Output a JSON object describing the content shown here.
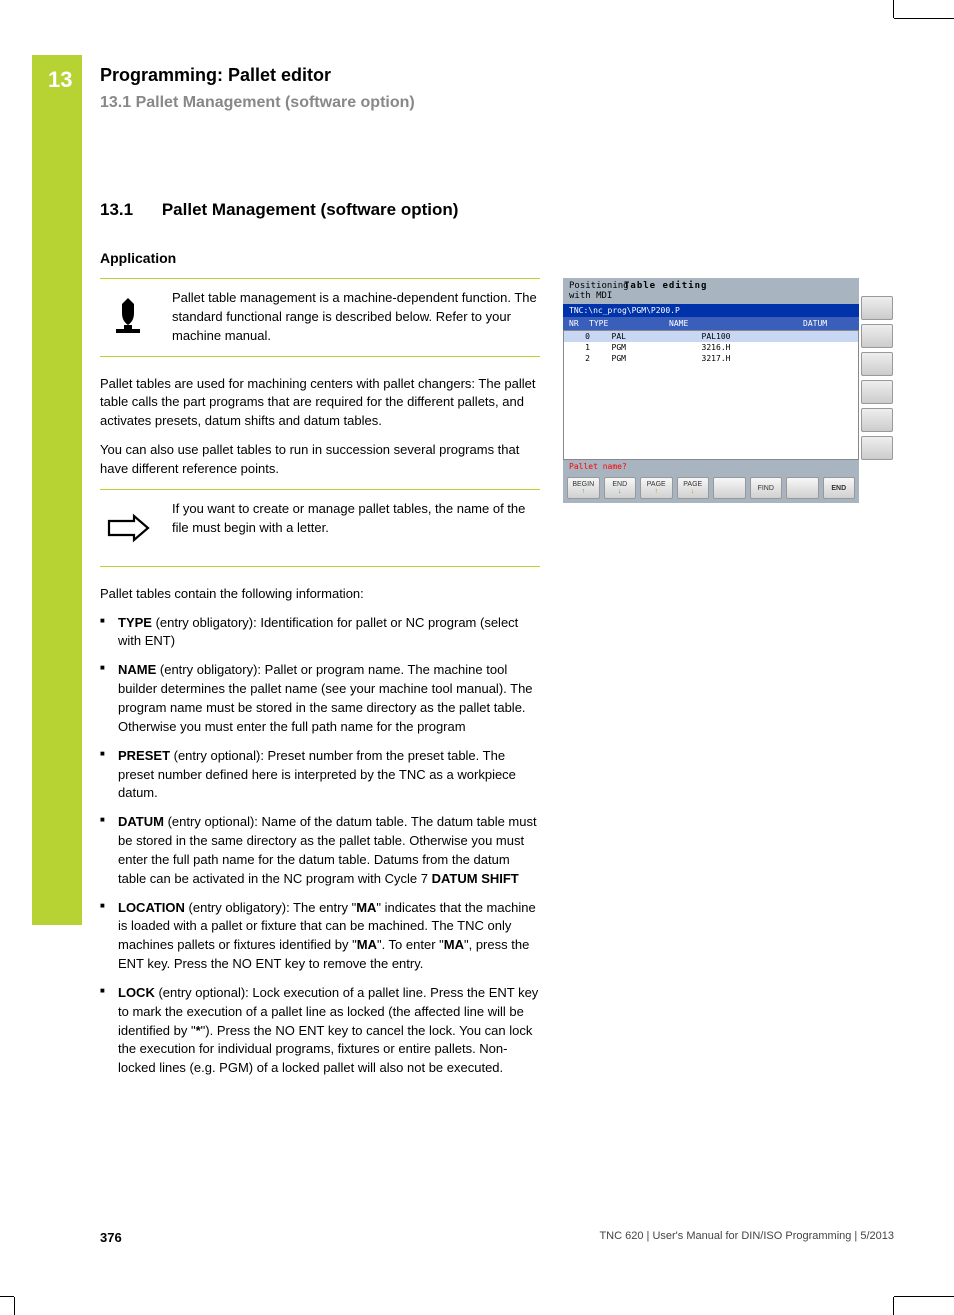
{
  "chapter_num": "13",
  "top_header": {
    "line1": "Programming: Pallet editor",
    "line2": "13.1   Pallet Management (software option)"
  },
  "section_title": {
    "num": "13.1",
    "text": "Pallet Management (software option)"
  },
  "subhead": "Application",
  "callout1_text": "Pallet table management is a machine-dependent function. The standard functional range is described below. Refer to your machine manual.",
  "para1": "Pallet tables are used for machining centers with pallet changers: The pallet table calls the part programs that are required for the different pallets, and activates presets, datum shifts and datum tables.",
  "para2": "You can also use pallet tables to run in succession several programs that have different reference points.",
  "callout2_text": "If you want to create or manage pallet tables, the name of the file must begin with a letter.",
  "para3": "Pallet tables contain the following information:",
  "fields": [
    {
      "name": "TYPE",
      "body": " (entry obligatory): Identification for pallet or NC program (select with ENT)"
    },
    {
      "name": "NAME",
      "body": " (entry obligatory): Pallet or program name. The machine tool builder determines the pallet name (see your machine tool manual). The program name must be stored in the same directory as the pallet table. Otherwise you must enter the full path name for the program"
    },
    {
      "name": "PRESET",
      "body": " (entry optional): Preset number from the preset table. The preset number defined here is interpreted by the TNC as a workpiece datum."
    },
    {
      "name": "DATUM",
      "body": " (entry optional): Name of the datum table. The datum table must be stored in the same directory as the pallet table. Otherwise you must enter the full path name for the datum table. Datums from the datum table can be activated in the NC program with Cycle 7 ",
      "tail_bold": "DATUM SHIFT"
    },
    {
      "name": "LOCATION",
      "body": " (entry obligatory): The entry \"",
      "mid_bold": "MA",
      "body2": "\" indicates that the machine is loaded with a pallet or fixture that can be machined. The TNC only machines pallets or fixtures identified by \"",
      "mid_bold2": "MA",
      "body3": "\". To enter \"",
      "mid_bold3": "MA",
      "body4": "\", press the ENT key. Press the NO ENT key to remove the entry."
    },
    {
      "name": "LOCK",
      "body": " (entry optional): Lock execution of a pallet line. Press the ENT key to mark the execution of a pallet line as locked (the affected line will be identified by \"",
      "mid_bold": "*",
      "body2": "\"). Press the NO ENT key to cancel the lock. You can lock the execution for individual programs, fixtures or entire pallets. Non-locked lines (e.g. PGM) of a locked pallet will also not be executed."
    }
  ],
  "screenshot": {
    "mode": "Positioning\nwith MDI",
    "title": "Table editing",
    "path": "TNC:\\nc_prog\\PGM\\P200.P",
    "cols": [
      "NR",
      "TYPE",
      "NAME",
      "DATUM"
    ],
    "rows": [
      {
        "nr": "0",
        "type": "PAL",
        "name": "PAL100",
        "datum": ""
      },
      {
        "nr": "1",
        "type": "PGM",
        "name": "3216.H",
        "datum": ""
      },
      {
        "nr": "2",
        "type": "PGM",
        "name": "3217.H",
        "datum": ""
      }
    ],
    "prompt": "Pallet name?",
    "buttons": [
      "BEGIN",
      "END",
      "PAGE",
      "PAGE",
      "",
      "FIND",
      "",
      "END"
    ]
  },
  "footer": {
    "page": "376",
    "meta": "TNC 620 | User's Manual for DIN/ISO Programming | 5/2013"
  }
}
